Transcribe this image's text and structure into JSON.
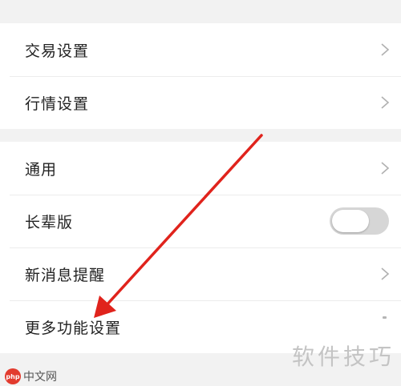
{
  "settings": {
    "groups": [
      {
        "items": [
          {
            "label": "交易设置",
            "accessory": "chevron-right-icon"
          },
          {
            "label": "行情设置",
            "accessory": "chevron-right-icon"
          }
        ]
      },
      {
        "items": [
          {
            "label": "通用",
            "accessory": "chevron-right-icon"
          },
          {
            "label": "长辈版",
            "accessory": "toggle",
            "toggle_on": false
          },
          {
            "label": "新消息提醒",
            "accessory": "chevron-right-icon"
          },
          {
            "label": "更多功能设置",
            "accessory": "none"
          }
        ]
      }
    ]
  },
  "annotation": {
    "arrow_color": "#e0231c"
  },
  "watermarks": {
    "right_text": "软件技巧",
    "left_logo": "php",
    "left_text": "中文网"
  },
  "colors": {
    "background": "#f2f2f2",
    "row_background": "#ffffff",
    "chevron": "#b0b0b0",
    "toggle_off_track": "#d6d6d6"
  }
}
